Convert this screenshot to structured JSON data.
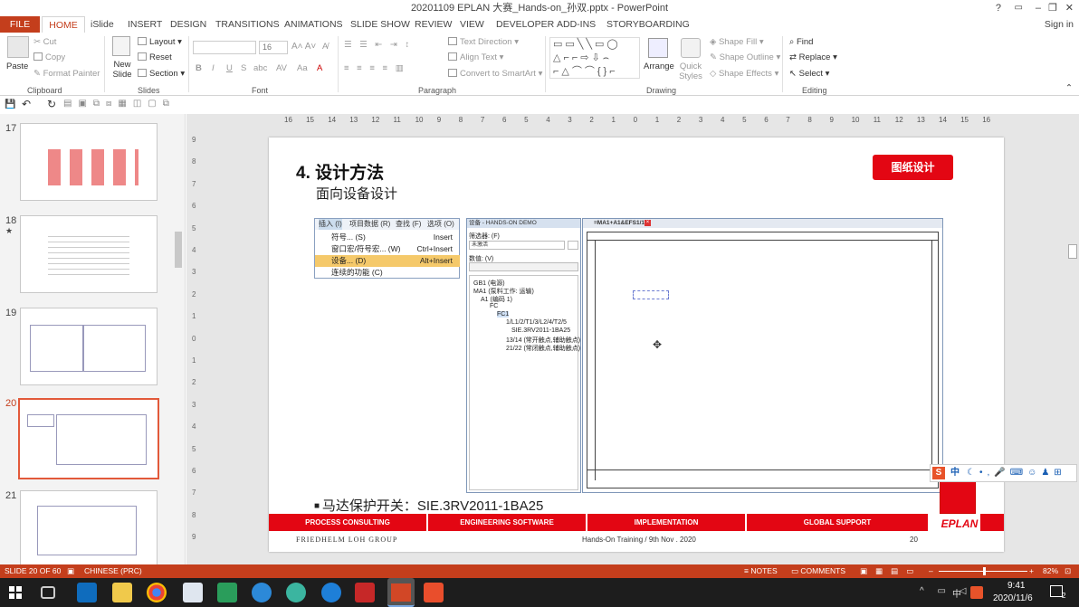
{
  "window": {
    "title": "20201109 EPLAN 大赛_Hands-on_孙双.pptx - PowerPoint",
    "help": "?",
    "signin": "Sign in"
  },
  "ribbon_tabs": [
    "FILE",
    "HOME",
    "iSlide",
    "INSERT",
    "DESIGN",
    "TRANSITIONS",
    "ANIMATIONS",
    "SLIDE SHOW",
    "REVIEW",
    "VIEW",
    "DEVELOPER",
    "ADD-INS",
    "STORYBOARDING"
  ],
  "clipboard": {
    "paste": "Paste",
    "cut": "Cut",
    "copy": "Copy",
    "format_painter": "Format Painter",
    "label": "Clipboard"
  },
  "slides_group": {
    "new_slide": "New Slide",
    "layout": "Layout",
    "reset": "Reset",
    "section": "Section",
    "label": "Slides"
  },
  "font_group": {
    "size": "16",
    "label": "Font",
    "bold": "B",
    "italic": "I",
    "underline": "U",
    "strike": "S",
    "shadow": "abc"
  },
  "paragraph_group": {
    "text_direction": "Text Direction",
    "align_text": "Align Text",
    "smartart": "Convert to SmartArt",
    "label": "Paragraph"
  },
  "drawing_group": {
    "arrange": "Arrange",
    "quick_styles": "Quick Styles",
    "shape_fill": "Shape Fill",
    "shape_outline": "Shape Outline",
    "shape_effects": "Shape Effects",
    "label": "Drawing"
  },
  "editing_group": {
    "find": "Find",
    "replace": "Replace",
    "select": "Select",
    "label": "Editing"
  },
  "thumbnails": [
    {
      "num": "17"
    },
    {
      "num": "18",
      "star": "★"
    },
    {
      "num": "19"
    },
    {
      "num": "20"
    },
    {
      "num": "21"
    }
  ],
  "ruler_ticks": [
    "16",
    "15",
    "14",
    "13",
    "12",
    "11",
    "10",
    "9",
    "8",
    "7",
    "6",
    "5",
    "4",
    "3",
    "2",
    "1",
    "0",
    "1",
    "2",
    "3",
    "4",
    "5",
    "6",
    "7",
    "8",
    "9",
    "10",
    "11",
    "12",
    "13",
    "14",
    "15",
    "16"
  ],
  "vruler_ticks": [
    "9",
    "8",
    "7",
    "6",
    "5",
    "4",
    "3",
    "2",
    "1",
    "0",
    "1",
    "2",
    "3",
    "4",
    "5",
    "6",
    "7",
    "8",
    "9"
  ],
  "slide": {
    "title": "4. 设计方法",
    "subtitle": "面向设备设计",
    "badge": "图纸设计",
    "bullet": "马达保护开关：SIE.3RV2011-1BA25",
    "footer_left": "FRIEDHELM LOH GROUP",
    "footer_center": "Hands-On Training / 9th Nov . 2020",
    "footer_page": "20",
    "bars": [
      "PROCESS CONSULTING",
      "ENGINEERING SOFTWARE",
      "IMPLEMENTATION",
      "GLOBAL SUPPORT"
    ],
    "logo": "EPLAN"
  },
  "menu": {
    "header": [
      "插入 (I)",
      "项目数据 (R)",
      "查找 (F)",
      "选项 (O)"
    ],
    "items": [
      {
        "label": "符号... (S)",
        "key": "Insert"
      },
      {
        "label": "窗口宏/符号宏... (W)",
        "key": "Ctrl+Insert"
      },
      {
        "label": "设备... (D)",
        "key": "Alt+Insert"
      },
      {
        "label": "连续的功能 (C)",
        "key": ""
      }
    ]
  },
  "device_panel": {
    "title": "设备 - HANDS-ON DEMO",
    "filter_label": "筛选器: (F)",
    "filter_value": "未激活",
    "value_label": "数值: (V)",
    "tree": [
      "GB1 (电源)",
      "MA1 (泵料工作: 运输)",
      "A1 (编码 1)",
      "FC",
      "FC1",
      "1/L1/2/T1/3/L2/4/T2/5",
      "SIE.3RV2011-1BA25",
      "13/14 (常开触点,辅助触点)",
      "21/22 (常闭触点,辅助触点)"
    ]
  },
  "drawing_tab": "=MA1+A1&EFS1/1",
  "ime": {
    "lang": "中"
  },
  "status": {
    "slide": "SLIDE 20 OF 60",
    "lang": "CHINESE (PRC)",
    "notes": "NOTES",
    "comments": "COMMENTS",
    "zoom": "82%"
  },
  "taskbar": {
    "time": "9:41",
    "date": "2020/11/6",
    "ime": "中",
    "notif": "2"
  },
  "colors": {
    "accent": "#c43e1c",
    "eplan_red": "#e30613"
  }
}
